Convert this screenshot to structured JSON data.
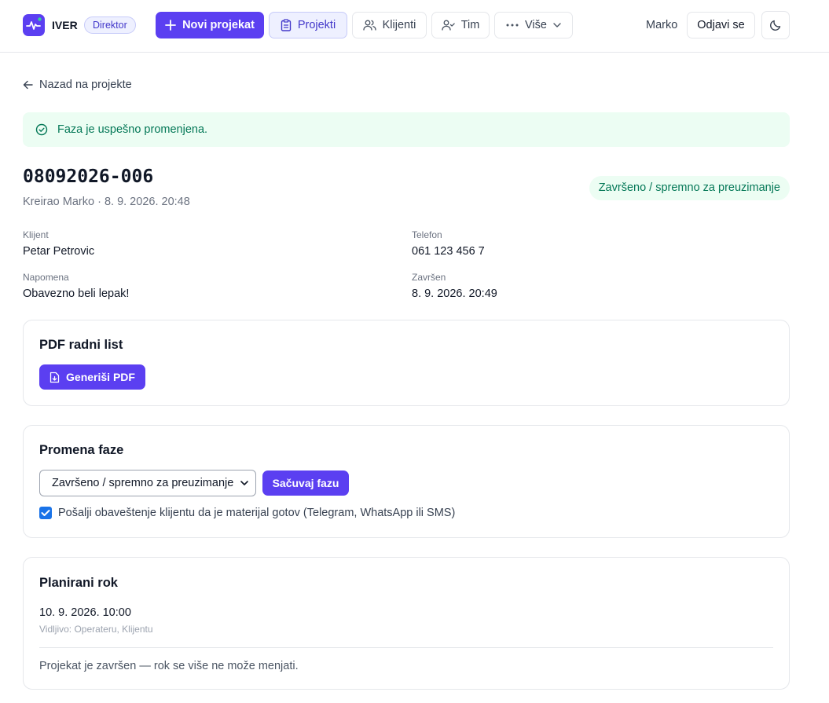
{
  "header": {
    "brand": "IVER",
    "role_badge": "Direktor",
    "nav": {
      "new_project": "Novi projekat",
      "projects": "Projekti",
      "clients": "Klijenti",
      "team": "Tim",
      "more": "Više"
    },
    "user_name": "Marko",
    "logout": "Odjavi se"
  },
  "back_link": "Nazad na projekte",
  "alert": "Faza je uspešno promenjena.",
  "project": {
    "code": "08092026-006",
    "created": "Kreirao Marko · 8. 9. 2026. 20:48",
    "status": "Završeno / spremno za preuzimanje",
    "fields": {
      "client_label": "Klijent",
      "client_value": "Petar Petrovic",
      "phone_label": "Telefon",
      "phone_value": "061 123 456 7",
      "note_label": "Napomena",
      "note_value": "Obavezno beli lepak!",
      "completed_label": "Završen",
      "completed_value": "8. 9. 2026. 20:49"
    }
  },
  "pdf_card": {
    "title": "PDF radni list",
    "button": "Generiši PDF"
  },
  "phase_card": {
    "title": "Promena faze",
    "selected_phase": "Završeno / spremno za preuzimanje",
    "save_button": "Sačuvaj fazu",
    "notify_checked": true,
    "notify_label": "Pošalji obaveštenje klijentu da je materijal gotov (Telegram, WhatsApp ili SMS)"
  },
  "deadline_card": {
    "title": "Planirani rok",
    "value": "10. 9. 2026. 10:00",
    "visibility": "Vidljivo: Operateru, Klijentu",
    "note": "Projekat je završen — rok se više ne može menjati."
  },
  "colors": {
    "accent": "#5b3ff1",
    "success_bg": "#ecfdf3",
    "success_text": "#047857",
    "border": "#e5e7eb"
  }
}
